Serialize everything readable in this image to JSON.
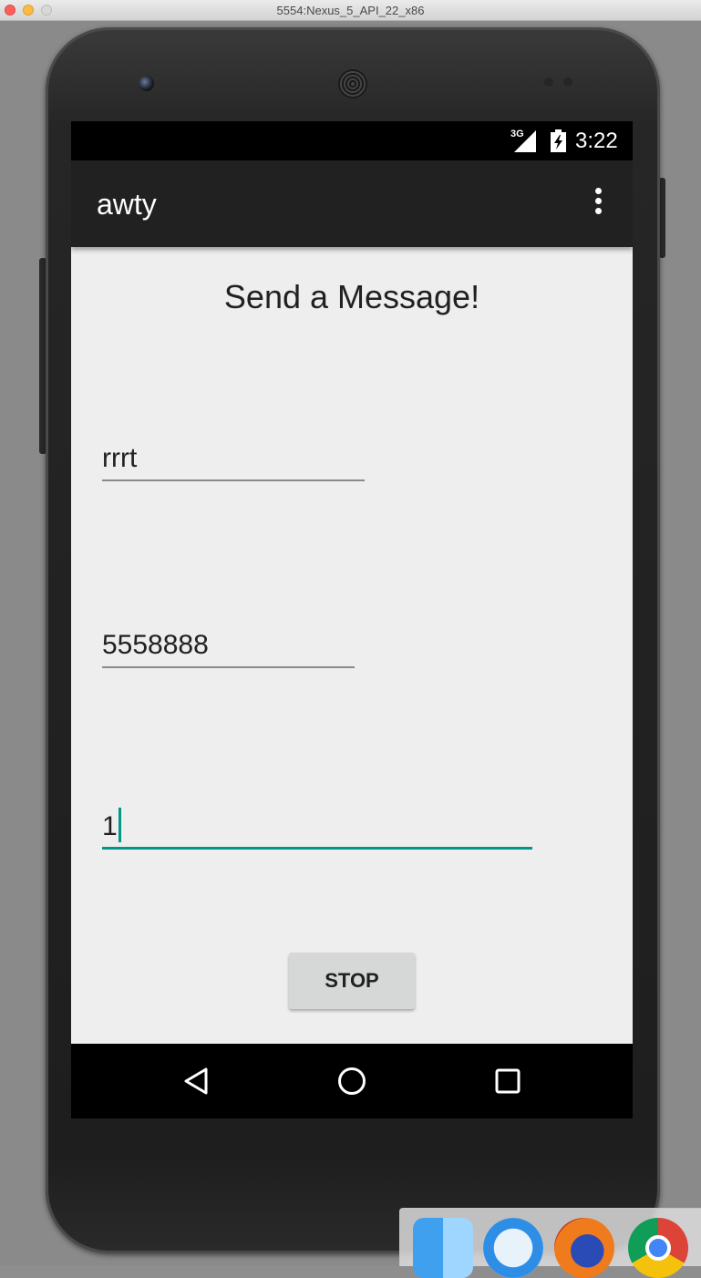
{
  "window": {
    "title": "5554:Nexus_5_API_22_x86"
  },
  "status_bar": {
    "network": "3G",
    "time": "3:22"
  },
  "app_bar": {
    "title": "awty",
    "overflow_icon": "more-vert-icon"
  },
  "main": {
    "headline": "Send a Message!",
    "fields": [
      {
        "name": "message",
        "value": "rrrt"
      },
      {
        "name": "phone_number",
        "value": "5558888"
      },
      {
        "name": "interval",
        "value": "1",
        "focused": true
      }
    ],
    "stop_button_label": "STOP"
  },
  "nav_bar": {
    "buttons": [
      "back-icon",
      "home-icon",
      "recents-icon"
    ]
  },
  "dock": {
    "apps": [
      "finder-icon",
      "safari-icon",
      "firefox-icon",
      "chrome-icon"
    ]
  },
  "colors": {
    "accent": "#009688",
    "app_bar": "#212121",
    "background": "#eeeeee",
    "button": "#d6d7d7"
  }
}
